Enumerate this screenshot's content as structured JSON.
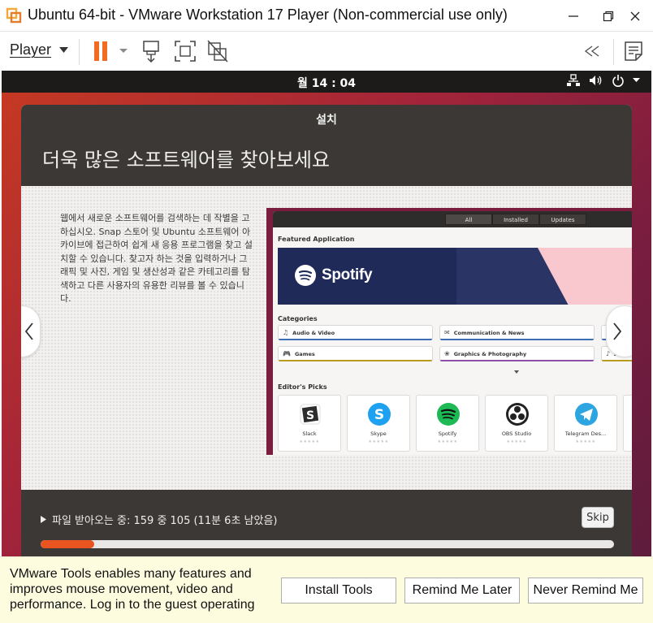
{
  "window": {
    "title": "Ubuntu 64-bit - VMware Workstation 17 Player (Non-commercial use only)",
    "icons": [
      "vmware-logo-icon",
      "minimize-icon",
      "maximize-icon",
      "close-icon"
    ]
  },
  "toolbar": {
    "player_label": "Player",
    "icons": [
      "pause-icon",
      "send-ctrl-alt-del-icon",
      "full-screen-icon",
      "unity-icon",
      "collapse-icon",
      "library-icon"
    ],
    "pause_color": "#f26b22"
  },
  "gnome_bar": {
    "clock": "월 14 : 04",
    "tray_icons": [
      "network-icon",
      "volume-icon",
      "power-icon",
      "caret-down-icon"
    ]
  },
  "installer": {
    "title": "설치",
    "heading": "더욱 많은 소프트웨어를 찾아보세요",
    "description": "웹에서 새로운 소프트웨어를 검색하는 데 작별을 고하십시오. Snap 스토어 및 Ubuntu 소프트웨어 아카이브에 접근하여 쉽게 새 응용 프로그램을 찾고 설치할 수 있습니다. 찾고자 하는 것을 입력하거나 그래픽 및 사진, 게임 및 생산성과 같은 카테고리를 탐색하고 다른 사용자의 유용한 리뷰를 볼 수 있습니다.",
    "slide": {
      "tabs": [
        {
          "label": "All",
          "active": true
        },
        {
          "label": "Installed",
          "active": false
        },
        {
          "label": "Updates",
          "active": false
        }
      ],
      "featured_label": "Featured Application",
      "featured_app": "Spotify",
      "categories_label": "Categories",
      "categories": [
        {
          "label": "Audio & Video",
          "color": "#3c6fb4"
        },
        {
          "label": "Communication & News",
          "color": "#3c6fb4"
        },
        {
          "label": "Games",
          "color": "#b89b1f"
        },
        {
          "label": "Graphics & Photography",
          "color": "#8e4fa8"
        },
        {
          "label": "A",
          "color": "#b89b1f"
        }
      ],
      "editors_picks_label": "Editor's Picks",
      "picks": [
        {
          "name": "Slack",
          "icon": "slack-icon",
          "color": "#ffffff"
        },
        {
          "name": "Skype",
          "icon": "skype-icon",
          "color": "#1ea1f1"
        },
        {
          "name": "Spotify",
          "icon": "spotify-icon",
          "color": "#1db954"
        },
        {
          "name": "OBS Studio",
          "icon": "obs-icon",
          "color": "#222222"
        },
        {
          "name": "Telegram Des...",
          "icon": "telegram-icon",
          "color": "#2ca5e0"
        }
      ],
      "stars": "★★★★★"
    },
    "progress_text": "파일 받아오는 중: 159 중 105 (11분 6초 남았음)",
    "skip_label": "Skip",
    "progress_percent": 9.4,
    "accent": "#e95420"
  },
  "notification": {
    "text": "VMware Tools enables many features and improves mouse movement, video and performance. Log in to the guest operating",
    "install_label": "Install Tools",
    "remind_label": "Remind Me Later",
    "never_label": "Never Remind Me"
  }
}
